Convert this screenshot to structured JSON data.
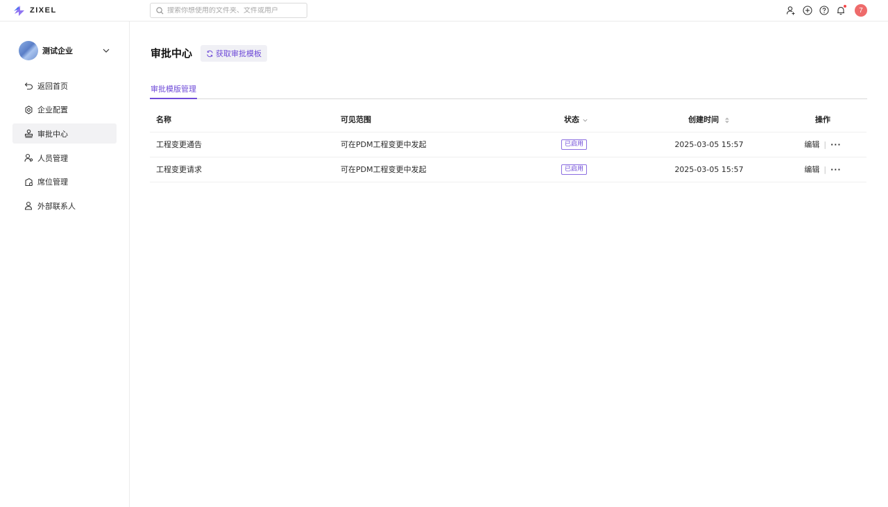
{
  "app": {
    "brand": "ZIXEL"
  },
  "search": {
    "placeholder": "搜索你想使用的文件夹、文件或用户"
  },
  "topbar": {
    "avatar_letter": "7"
  },
  "sidebar": {
    "company_name": "测试企业",
    "items": [
      {
        "label": "返回首页",
        "icon": "back-icon"
      },
      {
        "label": "企业配置",
        "icon": "gear-icon"
      },
      {
        "label": "审批中心",
        "icon": "stamp-icon",
        "active": true
      },
      {
        "label": "人员管理",
        "icon": "users-icon"
      },
      {
        "label": "席位管理",
        "icon": "seat-icon"
      },
      {
        "label": "外部联系人",
        "icon": "contact-icon"
      }
    ]
  },
  "main": {
    "title": "审批中心",
    "fetch_button": "获取审批模板",
    "tab": "审批模版管理",
    "table": {
      "headers": {
        "name": "名称",
        "scope": "可见范围",
        "status": "状态",
        "created": "创建时间",
        "ops": "操作"
      },
      "rows": [
        {
          "name": "工程变更通告",
          "scope": "可在PDM工程变更中发起",
          "status": "已启用",
          "created": "2025-03-05 15:57",
          "edit": "编辑",
          "more": "···"
        },
        {
          "name": "工程变更请求",
          "scope": "可在PDM工程变更中发起",
          "status": "已启用",
          "created": "2025-03-05 15:57",
          "edit": "编辑",
          "more": "···"
        }
      ]
    }
  },
  "colors": {
    "accent": "#6f4bd8",
    "avatar": "#ee6b6b",
    "notify_dot": "#f5474a"
  }
}
